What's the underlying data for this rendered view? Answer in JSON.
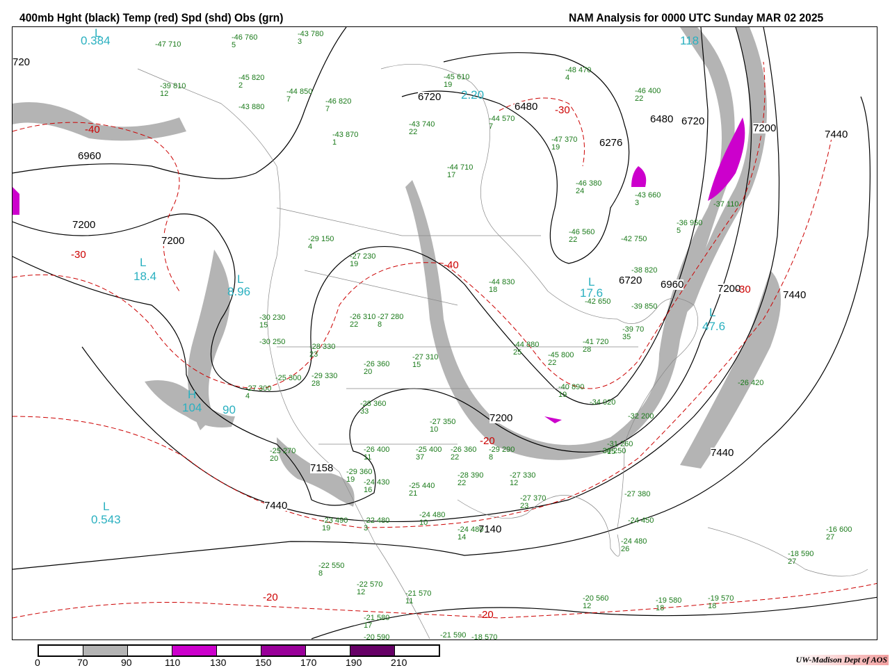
{
  "header": {
    "left_title": "400mb Hght (black) Temp (red) Spd (shd) Obs (grn)",
    "right_title": "NAM Analysis for 0000 UTC Sunday  MAR 02 2025"
  },
  "colors": {
    "height": "#000000",
    "temp": "#cc0000",
    "obs": "#1a7a1a",
    "speed_label": "#2ab0c0",
    "shade_70": "#b4b4b4",
    "shade_110": "#cc00cc",
    "shade_150": "#990099",
    "shade_190": "#660066"
  },
  "height_labels": [
    "6720",
    "6480",
    "6276",
    "6480",
    "6720",
    "7200",
    "7440",
    "6960",
    "7200",
    "7200",
    "720",
    "7200",
    "7440",
    "7200",
    "7158",
    "7440",
    "7140",
    "7440",
    "6720",
    "6960"
  ],
  "temp_labels": [
    "-40",
    "-30",
    "-40",
    "-30",
    "-20",
    "-20",
    "-30",
    "-20"
  ],
  "centers": {
    "low": "L",
    "high": "H"
  },
  "speed_labels": [
    "0.384",
    "18.4",
    "8.96",
    "17.6",
    "47.6",
    "0.543",
    "104",
    "90",
    "118",
    "2.20"
  ],
  "obs": [
    {
      "t": "-47",
      "h": "710",
      "d": ""
    },
    {
      "t": "-46",
      "h": "760",
      "d": "5"
    },
    {
      "t": "-43",
      "h": "780",
      "d": "3"
    },
    {
      "t": "-39",
      "h": "810",
      "d": "12"
    },
    {
      "t": "-45",
      "h": "820",
      "d": "2"
    },
    {
      "t": "-44",
      "h": "850",
      "d": "7"
    },
    {
      "t": "-43",
      "h": "880",
      "d": ""
    },
    {
      "t": "-46",
      "h": "820",
      "d": "7"
    },
    {
      "t": "-43",
      "h": "870",
      "d": "1"
    },
    {
      "t": "-43",
      "h": "740",
      "d": "22"
    },
    {
      "t": "-44",
      "h": "710",
      "d": "17"
    },
    {
      "t": "-45",
      "h": "610",
      "d": "19"
    },
    {
      "t": "-44",
      "h": "570",
      "d": "7"
    },
    {
      "t": "-48",
      "h": "470",
      "d": "4"
    },
    {
      "t": "-46",
      "h": "400",
      "d": "22"
    },
    {
      "t": "-47",
      "h": "370",
      "d": "19"
    },
    {
      "t": "-46",
      "h": "380",
      "d": "24"
    },
    {
      "t": "-43",
      "h": "660",
      "d": "3"
    },
    {
      "t": "-42",
      "h": "750",
      "d": ""
    },
    {
      "t": "-46",
      "h": "560",
      "d": "22"
    },
    {
      "t": "-29",
      "h": "150",
      "d": "4"
    },
    {
      "t": "-27",
      "h": "230",
      "d": "19"
    },
    {
      "t": "-44",
      "h": "830",
      "d": "18"
    },
    {
      "t": "-42",
      "h": "650",
      "d": ""
    },
    {
      "t": "-26",
      "h": "310",
      "d": "22"
    },
    {
      "t": "-27",
      "h": "280",
      "d": "8"
    },
    {
      "t": "-30",
      "h": "230",
      "d": "15"
    },
    {
      "t": "-30",
      "h": "250",
      "d": ""
    },
    {
      "t": "-28",
      "h": "330",
      "d": "23"
    },
    {
      "t": "-27",
      "h": "310",
      "d": "15"
    },
    {
      "t": "-26",
      "h": "360",
      "d": "20"
    },
    {
      "t": "-27",
      "h": "300",
      "d": "4"
    },
    {
      "t": "-25",
      "h": "300",
      "d": ""
    },
    {
      "t": "-29",
      "h": "330",
      "d": "28"
    },
    {
      "t": "-28",
      "h": "360",
      "d": "33"
    },
    {
      "t": "-27",
      "h": "350",
      "d": "10"
    },
    {
      "t": "-26",
      "h": "400",
      "d": "11"
    },
    {
      "t": "-25",
      "h": "400",
      "d": "37"
    },
    {
      "t": "-26",
      "h": "360",
      "d": "22"
    },
    {
      "t": "-29",
      "h": "290",
      "d": "8"
    },
    {
      "t": "-24",
      "h": "430",
      "d": "16"
    },
    {
      "t": "-25",
      "h": "440",
      "d": "21"
    },
    {
      "t": "-24",
      "h": "480",
      "d": "10"
    },
    {
      "t": "-23",
      "h": "490",
      "d": "19"
    },
    {
      "t": "-22",
      "h": "480",
      "d": "3"
    },
    {
      "t": "-24",
      "h": "480",
      "d": "14"
    },
    {
      "t": "-22",
      "h": "550",
      "d": "8"
    },
    {
      "t": "-22",
      "h": "570",
      "d": "12"
    },
    {
      "t": "-21",
      "h": "570",
      "d": "11"
    },
    {
      "t": "-21",
      "h": "580",
      "d": "17"
    },
    {
      "t": "-20",
      "h": "590",
      "d": ""
    },
    {
      "t": "-21",
      "h": "590",
      "d": ""
    },
    {
      "t": "-18",
      "h": "570",
      "d": ""
    },
    {
      "t": "-20",
      "h": "560",
      "d": "12"
    },
    {
      "t": "-19",
      "h": "580",
      "d": "18"
    },
    {
      "t": "-19",
      "h": "570",
      "d": "18"
    },
    {
      "t": "-18",
      "h": "590",
      "d": "27"
    },
    {
      "t": "-16",
      "h": "600",
      "d": "27"
    },
    {
      "t": "-24",
      "h": "480",
      "d": "26"
    },
    {
      "t": "-24",
      "h": "450",
      "d": ""
    },
    {
      "t": "-27",
      "h": "380",
      "d": ""
    },
    {
      "t": "-31",
      "h": "260",
      "d": "15"
    },
    {
      "t": "-32",
      "h": "200",
      "d": ""
    },
    {
      "t": "-26",
      "h": "420",
      "d": ""
    },
    {
      "t": "-37",
      "h": "110",
      "d": ""
    },
    {
      "t": "-36",
      "h": "950",
      "d": "5"
    },
    {
      "t": "-38",
      "h": "820",
      "d": ""
    },
    {
      "t": "-39",
      "h": "850",
      "d": ""
    },
    {
      "t": "-39",
      "h": "70",
      "d": "35"
    },
    {
      "t": "-41",
      "h": "720",
      "d": "28"
    },
    {
      "t": "-44",
      "h": "880",
      "d": "25"
    },
    {
      "t": "-45",
      "h": "800",
      "d": "22"
    },
    {
      "t": "-40",
      "h": "890",
      "d": "19"
    },
    {
      "t": "-34",
      "h": "020",
      "d": ""
    },
    {
      "t": "-27",
      "h": "330",
      "d": "12"
    },
    {
      "t": "-27",
      "h": "370",
      "d": "23"
    },
    {
      "t": "-30",
      "h": "250",
      "d": ""
    },
    {
      "t": "-29",
      "h": "360",
      "d": "19"
    },
    {
      "t": "-28",
      "h": "390",
      "d": "22"
    },
    {
      "t": "-25",
      "h": "270",
      "d": "20"
    }
  ],
  "legend": {
    "ticks": [
      "0",
      "70",
      "90",
      "110",
      "130",
      "150",
      "170",
      "190",
      "210"
    ]
  },
  "credit": "UW-Madison  Dept of AOS"
}
